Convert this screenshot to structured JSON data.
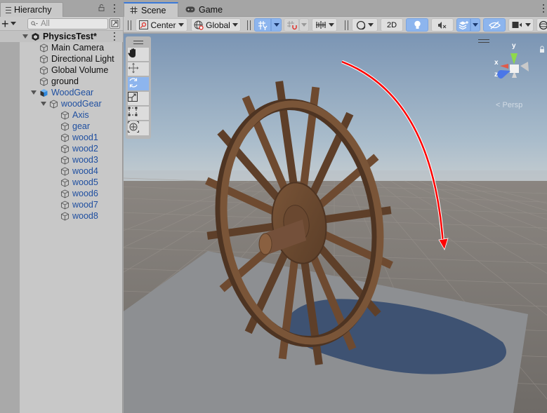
{
  "hierarchy": {
    "tab_label": "Hierarchy",
    "search_placeholder": "All",
    "scene": {
      "name": "PhysicsTest*",
      "expanded": true
    },
    "items": [
      {
        "label": "Main Camera",
        "depth": 1,
        "expander": "none",
        "color": "default",
        "icon": "gameobject-icon"
      },
      {
        "label": "Directional Light",
        "depth": 1,
        "expander": "none",
        "color": "default",
        "icon": "gameobject-icon"
      },
      {
        "label": "Global Volume",
        "depth": 1,
        "expander": "none",
        "color": "default",
        "icon": "gameobject-icon"
      },
      {
        "label": "ground",
        "depth": 1,
        "expander": "none",
        "color": "default",
        "icon": "gameobject-icon"
      },
      {
        "label": "WoodGear",
        "depth": 1,
        "expander": "expanded",
        "color": "prefab",
        "icon": "prefab-icon"
      },
      {
        "label": "woodGear",
        "depth": 2,
        "expander": "expanded",
        "color": "prefab",
        "icon": "gameobject-icon"
      },
      {
        "label": "Axis",
        "depth": 3,
        "expander": "none",
        "color": "prefab",
        "icon": "gameobject-icon"
      },
      {
        "label": "gear",
        "depth": 3,
        "expander": "none",
        "color": "prefab",
        "icon": "gameobject-icon"
      },
      {
        "label": "wood1",
        "depth": 3,
        "expander": "none",
        "color": "prefab",
        "icon": "gameobject-icon"
      },
      {
        "label": "wood2",
        "depth": 3,
        "expander": "none",
        "color": "prefab",
        "icon": "gameobject-icon"
      },
      {
        "label": "wood3",
        "depth": 3,
        "expander": "none",
        "color": "prefab",
        "icon": "gameobject-icon"
      },
      {
        "label": "wood4",
        "depth": 3,
        "expander": "none",
        "color": "prefab",
        "icon": "gameobject-icon"
      },
      {
        "label": "wood5",
        "depth": 3,
        "expander": "none",
        "color": "prefab",
        "icon": "gameobject-icon"
      },
      {
        "label": "wood6",
        "depth": 3,
        "expander": "none",
        "color": "prefab",
        "icon": "gameobject-icon"
      },
      {
        "label": "wood7",
        "depth": 3,
        "expander": "none",
        "color": "prefab",
        "icon": "gameobject-icon"
      },
      {
        "label": "wood8",
        "depth": 3,
        "expander": "none",
        "color": "prefab",
        "icon": "gameobject-icon"
      }
    ]
  },
  "scene_view": {
    "tabs": [
      {
        "label": "Scene",
        "icon": "grid-hash-icon",
        "active": true
      },
      {
        "label": "Game",
        "icon": "gamepad-icon",
        "active": false
      }
    ],
    "toolbar": {
      "pivot_mode": "Center",
      "pivot_rotation": "Global",
      "grid_snapping_active": true,
      "increment_snap_active": false,
      "view_2d_label": "2D",
      "lighting_on": true,
      "audio_on": false,
      "effects_on": true,
      "hidden_objects_toggle_on": true
    },
    "tools": [
      {
        "name": "hand-tool",
        "icon": "hand-icon",
        "active": false
      },
      {
        "name": "move-tool",
        "icon": "move-arrows-icon",
        "active": false
      },
      {
        "name": "rotate-tool",
        "icon": "rotate-icon",
        "active": true
      },
      {
        "name": "scale-tool",
        "icon": "scale-icon",
        "active": false
      },
      {
        "name": "rect-tool",
        "icon": "rect-transform-icon",
        "active": false
      },
      {
        "name": "transform-tool",
        "icon": "transform-all-icon",
        "active": false
      }
    ],
    "gizmo": {
      "axes": [
        "y",
        "x",
        "z"
      ],
      "projection_label": "Persp"
    },
    "annotation": {
      "type": "curved-arrow",
      "color": "#ff0000",
      "meaning": "clockwise rotation"
    },
    "colors": {
      "accent": "#3a79d8",
      "active_button": "#8db5ee",
      "prefab_text": "#1f4fa0",
      "sky_top": "#7f9ab8",
      "ground": "#7b7670",
      "plane": "#8a8c8f",
      "wood": "#6b4a31",
      "shadow": "#3e5272"
    }
  }
}
